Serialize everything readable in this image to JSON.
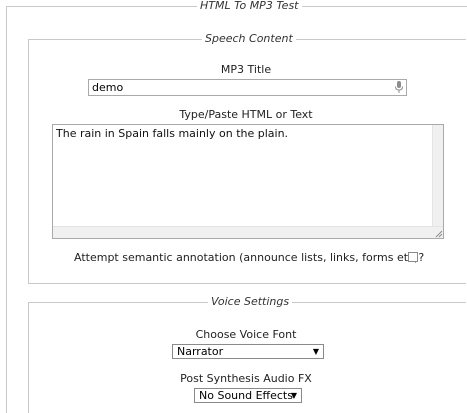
{
  "form": {
    "title": "HTML To MP3 Test"
  },
  "speech_content": {
    "legend": "Speech Content",
    "mp3_title_label": "MP3 Title",
    "mp3_title_value": "demo",
    "text_label": "Type/Paste HTML or Text",
    "text_value": "The rain in Spain falls mainly on the plain.",
    "semantic_label": "Attempt semantic annotation (announce lists, links, forms etc)?",
    "semantic_checked": false
  },
  "voice_settings": {
    "legend": "Voice Settings",
    "voice_font_label": "Choose Voice Font",
    "voice_font_value": "Narrator",
    "fx_label": "Post Synthesis Audio FX",
    "fx_value": "No Sound Effects"
  },
  "icons": {
    "mic": "microphone-icon",
    "dropdown": "chevron-down-icon",
    "resize": "resize-grip-icon"
  }
}
